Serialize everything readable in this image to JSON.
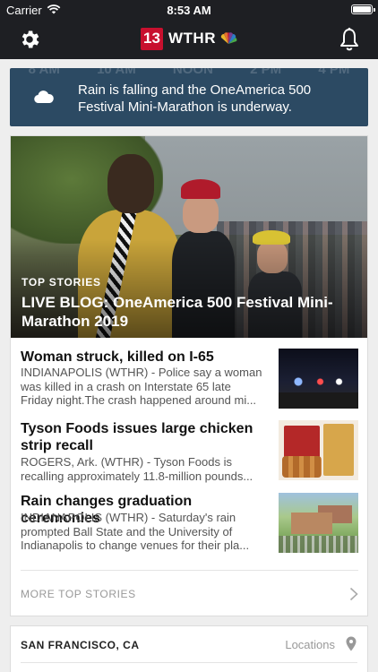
{
  "status_bar": {
    "carrier": "Carrier",
    "time": "8:53 AM"
  },
  "nav": {
    "logo_number": "13",
    "logo_text": "WTHR",
    "icons": [
      "gear-icon",
      "nbc-peacock-icon",
      "bell-icon"
    ]
  },
  "weather": {
    "hours": [
      "8 AM",
      "10 AM",
      "NOON",
      "2 PM",
      "4 PM"
    ],
    "icon": "cloud-icon",
    "message": "Rain is falling and the OneAmerica 500 Festival Mini-Marathon is underway."
  },
  "top_stories": {
    "hero": {
      "kicker": "TOP STORIES",
      "title": "LIVE BLOG: OneAmerica 500 Festival Mini-Marathon 2019"
    },
    "stories": [
      {
        "title": "Woman struck, killed on I-65",
        "desc_lines": [
          "INDIANAPOLIS (WTHR) - Police say a woman",
          "was killed in a crash on Interstate 65 late",
          "Friday night.The crash happened around mi..."
        ]
      },
      {
        "title": "Tyson Foods issues large chicken strip recall",
        "desc_lines": [
          "ROGERS, Ark. (WTHR) - Tyson Foods is",
          "recalling approximately 11.8-million pounds..."
        ]
      },
      {
        "title": "Rain changes graduation ceremonies",
        "desc_lines": [
          "INDIANAPOLIS (WTHR) - Saturday's rain",
          "prompted Ball State and the University of",
          "Indianapolis to change venues for their pla..."
        ]
      }
    ],
    "more_label": "MORE TOP STORIES"
  },
  "location": {
    "city": "SAN FRANCISCO, CA",
    "link_label": "Locations"
  },
  "colors": {
    "header_bg": "#1e1f23",
    "logo_red": "#c8102e",
    "weather_bg": "#2c4a63",
    "page_bg": "#eeeeee"
  }
}
